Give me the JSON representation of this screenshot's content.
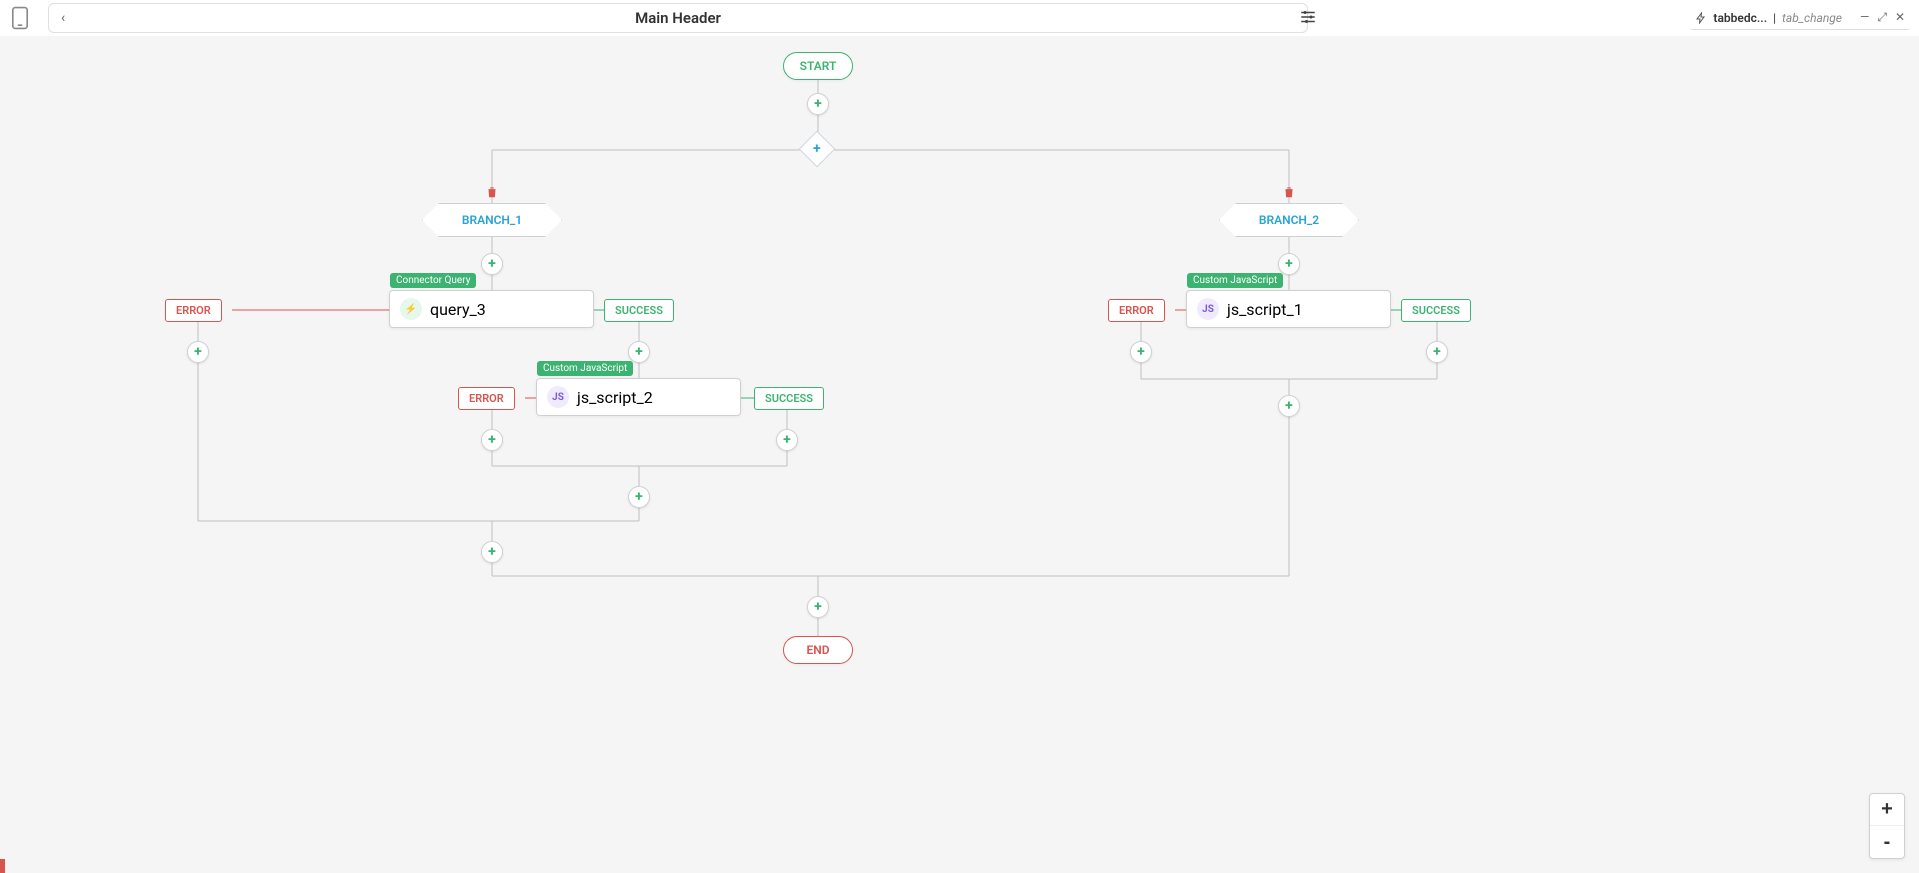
{
  "header": {
    "title": "Main Header",
    "back_glyph": "‹"
  },
  "tab": {
    "name": "tabbedc...",
    "subtab": "tab_change",
    "minimize": "—",
    "collapse": "⤢",
    "close": "✕"
  },
  "flow": {
    "start": "START",
    "end": "END",
    "diamond": "+",
    "branches": {
      "b1": "BRANCH_1",
      "b2": "BRANCH_2"
    },
    "blocks": {
      "q3": {
        "label": "Connector Query",
        "name": "query_3",
        "icon": "⚡"
      },
      "js1": {
        "label": "Custom JavaScript",
        "name": "js_script_1",
        "icon": "JS"
      },
      "js2": {
        "label": "Custom JavaScript",
        "name": "js_script_2",
        "icon": "JS"
      }
    },
    "tags": {
      "error": "ERROR",
      "success": "SUCCESS"
    },
    "add": "+"
  },
  "zoom": {
    "in": "+",
    "out": "-"
  }
}
